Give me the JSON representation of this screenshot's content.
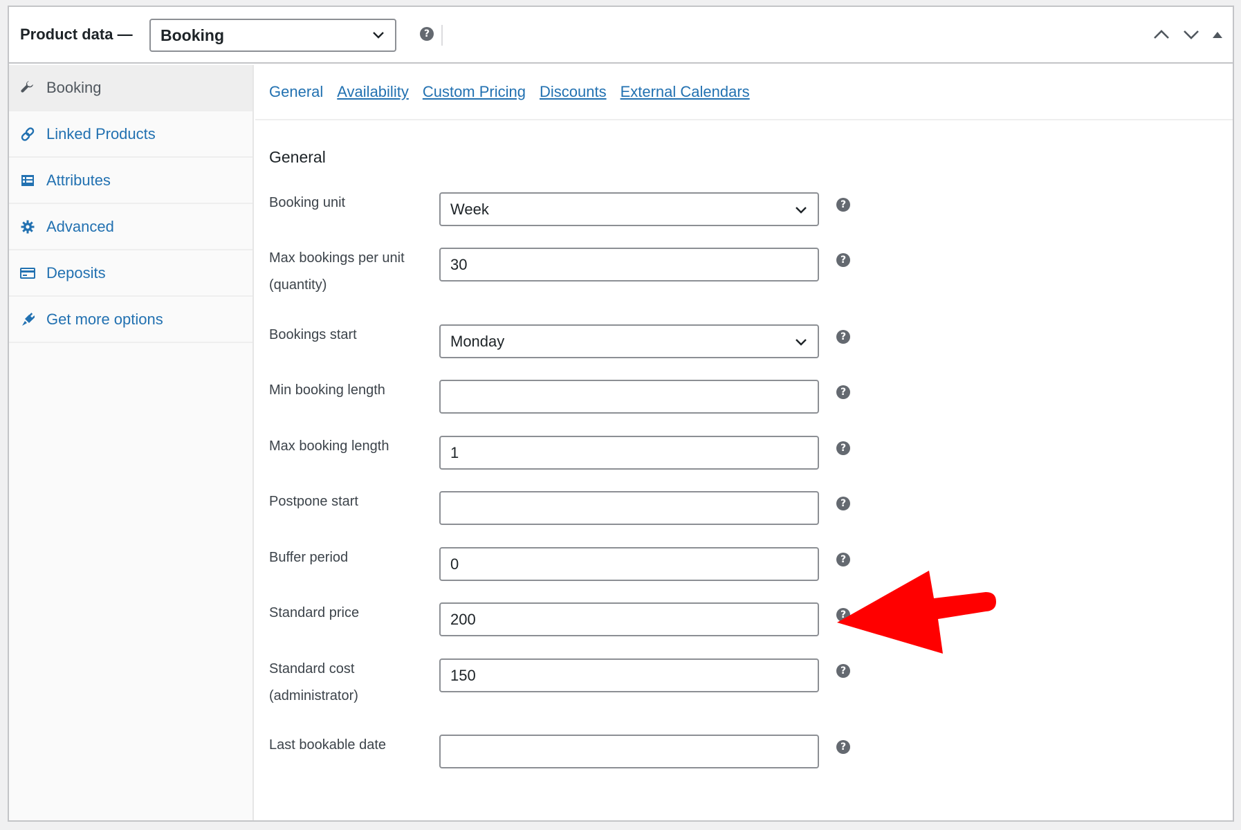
{
  "header": {
    "title": "Product data —",
    "product_type": "Booking"
  },
  "sidebar": {
    "items": [
      {
        "label": "Booking",
        "icon": "wrench-icon",
        "active": true
      },
      {
        "label": "Linked Products",
        "icon": "link-icon"
      },
      {
        "label": "Attributes",
        "icon": "list-table-icon"
      },
      {
        "label": "Advanced",
        "icon": "gear-icon"
      },
      {
        "label": "Deposits",
        "icon": "credit-card-icon"
      },
      {
        "label": "Get more options",
        "icon": "plugin-icon"
      }
    ]
  },
  "tabs": [
    "General",
    "Availability",
    "Custom Pricing",
    "Discounts",
    "External Calendars"
  ],
  "section": {
    "title": "General"
  },
  "fields": [
    {
      "label": "Booking unit",
      "value": "Week",
      "type": "select"
    },
    {
      "label": "Max bookings per unit (quantity)",
      "value": "30",
      "type": "input"
    },
    {
      "label": "Bookings start",
      "value": "Monday",
      "type": "select"
    },
    {
      "label": "Min booking length",
      "value": "",
      "type": "input"
    },
    {
      "label": "Max booking length",
      "value": "1",
      "type": "input"
    },
    {
      "label": "Postpone start",
      "value": "",
      "type": "input"
    },
    {
      "label": "Buffer period",
      "value": "0",
      "type": "input"
    },
    {
      "label": "Standard price",
      "value": "200",
      "type": "input"
    },
    {
      "label": "Standard cost (administrator)",
      "value": "150",
      "type": "input"
    },
    {
      "label": "Last bookable date",
      "value": "",
      "type": "input"
    }
  ],
  "help_glyph": "?",
  "colors": {
    "link": "#2271b1",
    "annotation_arrow": "#ff0000",
    "help_bg": "#646970"
  }
}
